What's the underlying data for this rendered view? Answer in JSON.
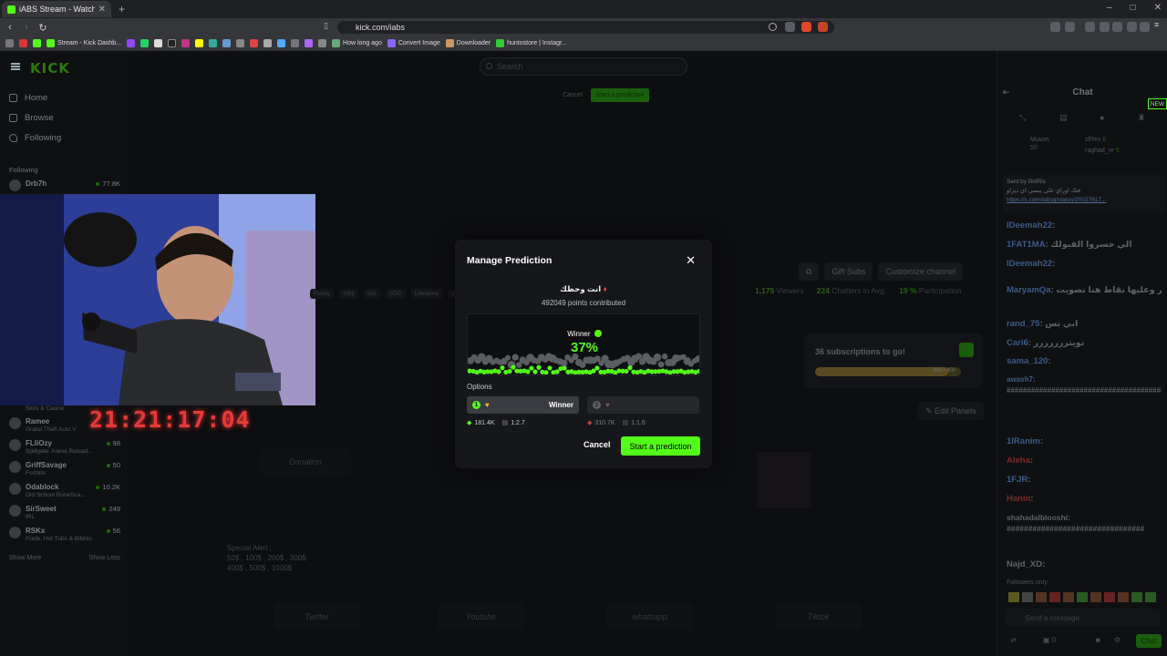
{
  "browser": {
    "tab_title": "iABS Stream - Watch Live on Kick",
    "url": "kick.com/iabs",
    "bookmarks": [
      "Stream - Kick Dashb...",
      "How long ago",
      "Convert Image",
      "Downloader",
      "huntostore | Instagr..."
    ]
  },
  "header": {
    "search_placeholder": "Search",
    "cancel_label": "Cancel",
    "start_prediction_label": "Start a prediction"
  },
  "sidebar": {
    "nav": [
      {
        "label": "Home",
        "icon": "home-icon"
      },
      {
        "label": "Browse",
        "icon": "browse-icon"
      },
      {
        "label": "Following",
        "icon": "heart-icon"
      }
    ],
    "following_header": "Following",
    "followed": [
      {
        "name": "Drb7h",
        "sub": "",
        "count": "77.8K"
      },
      {
        "name": "",
        "sub": "Slots & Casino",
        "count": ""
      },
      {
        "name": "Ramee",
        "sub": "Grand Theft Auto V",
        "count": ""
      },
      {
        "name": "FLIiOzy",
        "sub": "Spillgate: Arena Reload...",
        "count": "98"
      },
      {
        "name": "GriffSavage",
        "sub": "Fortnite",
        "count": "50"
      },
      {
        "name": "Odablock",
        "sub": "Old School RuneSca...",
        "count": "10.2K"
      },
      {
        "name": "SirSweet",
        "sub": "IRL",
        "count": "249"
      },
      {
        "name": "RSKx",
        "sub": "Pools, Hot Tubs & Bikinis",
        "count": "56"
      }
    ],
    "show_more": "Show More",
    "show_less": "Show Less"
  },
  "timer": "21:21:17:04",
  "channel": {
    "tags": [
      "Arabic",
      "Funny",
      "mtrp",
      "lvl1",
      "SOS",
      "Lewaone",
      "st"
    ],
    "subscribe_label": "Gift Subs",
    "customize_label": "Customize channel",
    "viewers": "1,175",
    "viewers_label": "Viewers",
    "chatters": "224",
    "chatters_label": "Chatters in Avg.",
    "participation": "19 %",
    "participation_label": "Participation",
    "subs_goal_text": "36 subscriptions to go!",
    "subs_goal_value": "364 / 400",
    "subs_goal_progress": 0.91,
    "edit_panels": "Edit Panels",
    "panel_labels": [
      "Donation",
      "Twitter",
      "Youtube",
      "whatsapp",
      "Tiktok"
    ],
    "special_alert": [
      "Special Alert :",
      "50$ , 100$ , 200$ , 300$",
      "400$ , 500$ , 1000$"
    ]
  },
  "chat": {
    "title": "Chat",
    "top_users": [
      {
        "name": "Muvxn",
        "points": "50"
      },
      {
        "name": "zFrex",
        "points": "6"
      },
      {
        "name": "raghad_re",
        "points": "5"
      }
    ],
    "pinned_sender": "Sent by  BotRix",
    "pinned_text": "فتك اوراي على يبسي اي ديزاو",
    "pinned_link": "https://x.com/iabsq/status/20027617...",
    "messages": [
      {
        "user": "lDeemah22",
        "text": ":"
      },
      {
        "user": "1FAT1MA",
        "text": ": الي خسروا القبولك"
      },
      {
        "user": "lDeemah22",
        "text": ":"
      },
      {
        "user": "MaryamQa",
        "text": ": عطه لموجبن بوتيكر وعليها نقاط هنا تصويت"
      },
      {
        "user": "rand_75",
        "text": ": ابي نس"
      },
      {
        "user": "Cari6",
        "text": ": تويتررررررر"
      },
      {
        "user": "sama_120",
        "text": ":"
      },
      {
        "user": "awash7",
        "text": ": ########################################"
      },
      {
        "user": "1lRanim",
        "text": ":"
      },
      {
        "user": "Aleha",
        "text": ":"
      },
      {
        "user": "1FJR",
        "text": ":"
      },
      {
        "user": "Hanin",
        "text": ":"
      },
      {
        "user": "shahadalblooshi",
        "text": ": ################################"
      },
      {
        "user": "Najd_XD",
        "text": ":"
      }
    ],
    "followers_only": "Followers only",
    "input_placeholder": "Send a message",
    "chat_button": "Chat",
    "points_count": "0",
    "new_badge": "NEW"
  },
  "modal": {
    "title": "Manage Prediction",
    "question": "انت وحظك",
    "points_contributed": "492049 points contributed",
    "winner_label": "Winner",
    "winner_percent": "37%",
    "options_label": "Options",
    "options": [
      {
        "index": "1",
        "winner_tag": "Winner",
        "points": "181.4K",
        "ratio": "1:2.7"
      },
      {
        "index": "2",
        "winner_tag": "",
        "points": "310.7K",
        "ratio": "1:1.6"
      }
    ],
    "cancel_label": "Cancel",
    "start_label": "Start a prediction"
  },
  "colors": {
    "kick_green": "#53fc18",
    "timer_red": "#e43a3a",
    "modal_bg": "#16171a"
  }
}
